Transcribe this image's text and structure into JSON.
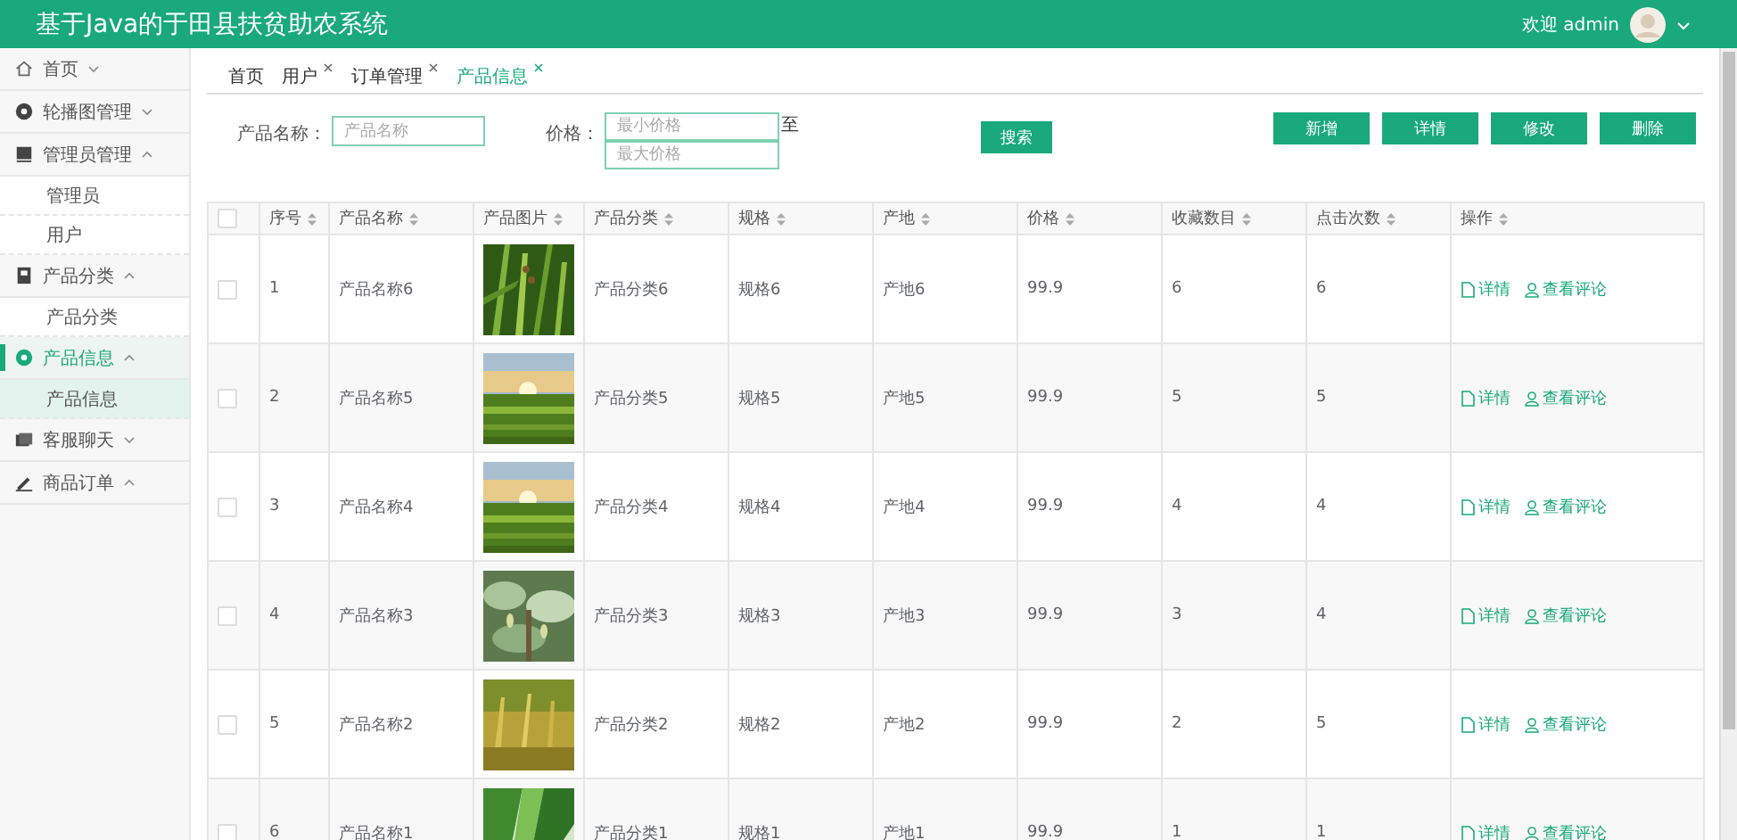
{
  "header": {
    "title": "基于Java的于田县扶贫助农系统",
    "welcome": "欢迎 admin"
  },
  "sidebar": {
    "items": [
      {
        "label": "首页",
        "expanded": false,
        "selected": false
      },
      {
        "label": "轮播图管理",
        "expanded": false,
        "selected": false
      },
      {
        "label": "管理员管理",
        "expanded": true,
        "selected": false,
        "children": [
          {
            "label": "管理员",
            "selected": false
          },
          {
            "label": "用户",
            "selected": false
          }
        ]
      },
      {
        "label": "产品分类",
        "expanded": true,
        "selected": false,
        "children": [
          {
            "label": "产品分类",
            "selected": false
          }
        ]
      },
      {
        "label": "产品信息",
        "expanded": true,
        "selected": true,
        "children": [
          {
            "label": "产品信息",
            "selected": true
          }
        ]
      },
      {
        "label": "客服聊天",
        "expanded": false,
        "selected": false
      },
      {
        "label": "商品订单",
        "expanded": true,
        "selected": false
      }
    ]
  },
  "tabs": [
    {
      "label": "首页",
      "closable": false,
      "selected": false
    },
    {
      "label": "用户",
      "closable": true,
      "selected": false
    },
    {
      "label": "订单管理",
      "closable": true,
      "selected": false
    },
    {
      "label": "产品信息",
      "closable": true,
      "selected": true
    }
  ],
  "search": {
    "name_label": "产品名称：",
    "name_placeholder": "产品名称",
    "price_label": "价格：",
    "min_placeholder": "最小价格",
    "max_placeholder": "最大价格",
    "range_word": "至",
    "button": "搜索"
  },
  "actions": [
    "新增",
    "详情",
    "修改",
    "删除"
  ],
  "table": {
    "columns": [
      "序号",
      "产品名称",
      "产品图片",
      "产品分类",
      "规格",
      "产地",
      "价格",
      "收藏数目",
      "点击次数",
      "操作"
    ],
    "select_all_checked": false,
    "rows": [
      {
        "checked": false,
        "cells": [
          "1",
          "产品名称6",
          "",
          "产品分类6",
          "规格6",
          "产地6",
          "99.9",
          "6",
          "6"
        ],
        "actions": [
          "详情",
          "查看评论"
        ]
      },
      {
        "checked": false,
        "cells": [
          "2",
          "产品名称5",
          "",
          "产品分类5",
          "规格5",
          "产地5",
          "99.9",
          "5",
          "5"
        ],
        "actions": [
          "详情",
          "查看评论"
        ]
      },
      {
        "checked": false,
        "cells": [
          "3",
          "产品名称4",
          "",
          "产品分类4",
          "规格4",
          "产地4",
          "99.9",
          "4",
          "4"
        ],
        "actions": [
          "详情",
          "查看评论"
        ]
      },
      {
        "checked": false,
        "cells": [
          "4",
          "产品名称3",
          "",
          "产品分类3",
          "规格3",
          "产地3",
          "99.9",
          "3",
          "4"
        ],
        "actions": [
          "详情",
          "查看评论"
        ]
      },
      {
        "checked": false,
        "cells": [
          "5",
          "产品名称2",
          "",
          "产品分类2",
          "规格2",
          "产地2",
          "99.9",
          "2",
          "5"
        ],
        "actions": [
          "详情",
          "查看评论"
        ]
      },
      {
        "checked": false,
        "cells": [
          "6",
          "产品名称1",
          "",
          "产品分类1",
          "规格1",
          "产地1",
          "99.9",
          "1",
          "1"
        ],
        "actions": [
          "详情",
          "查看评论"
        ]
      }
    ]
  }
}
